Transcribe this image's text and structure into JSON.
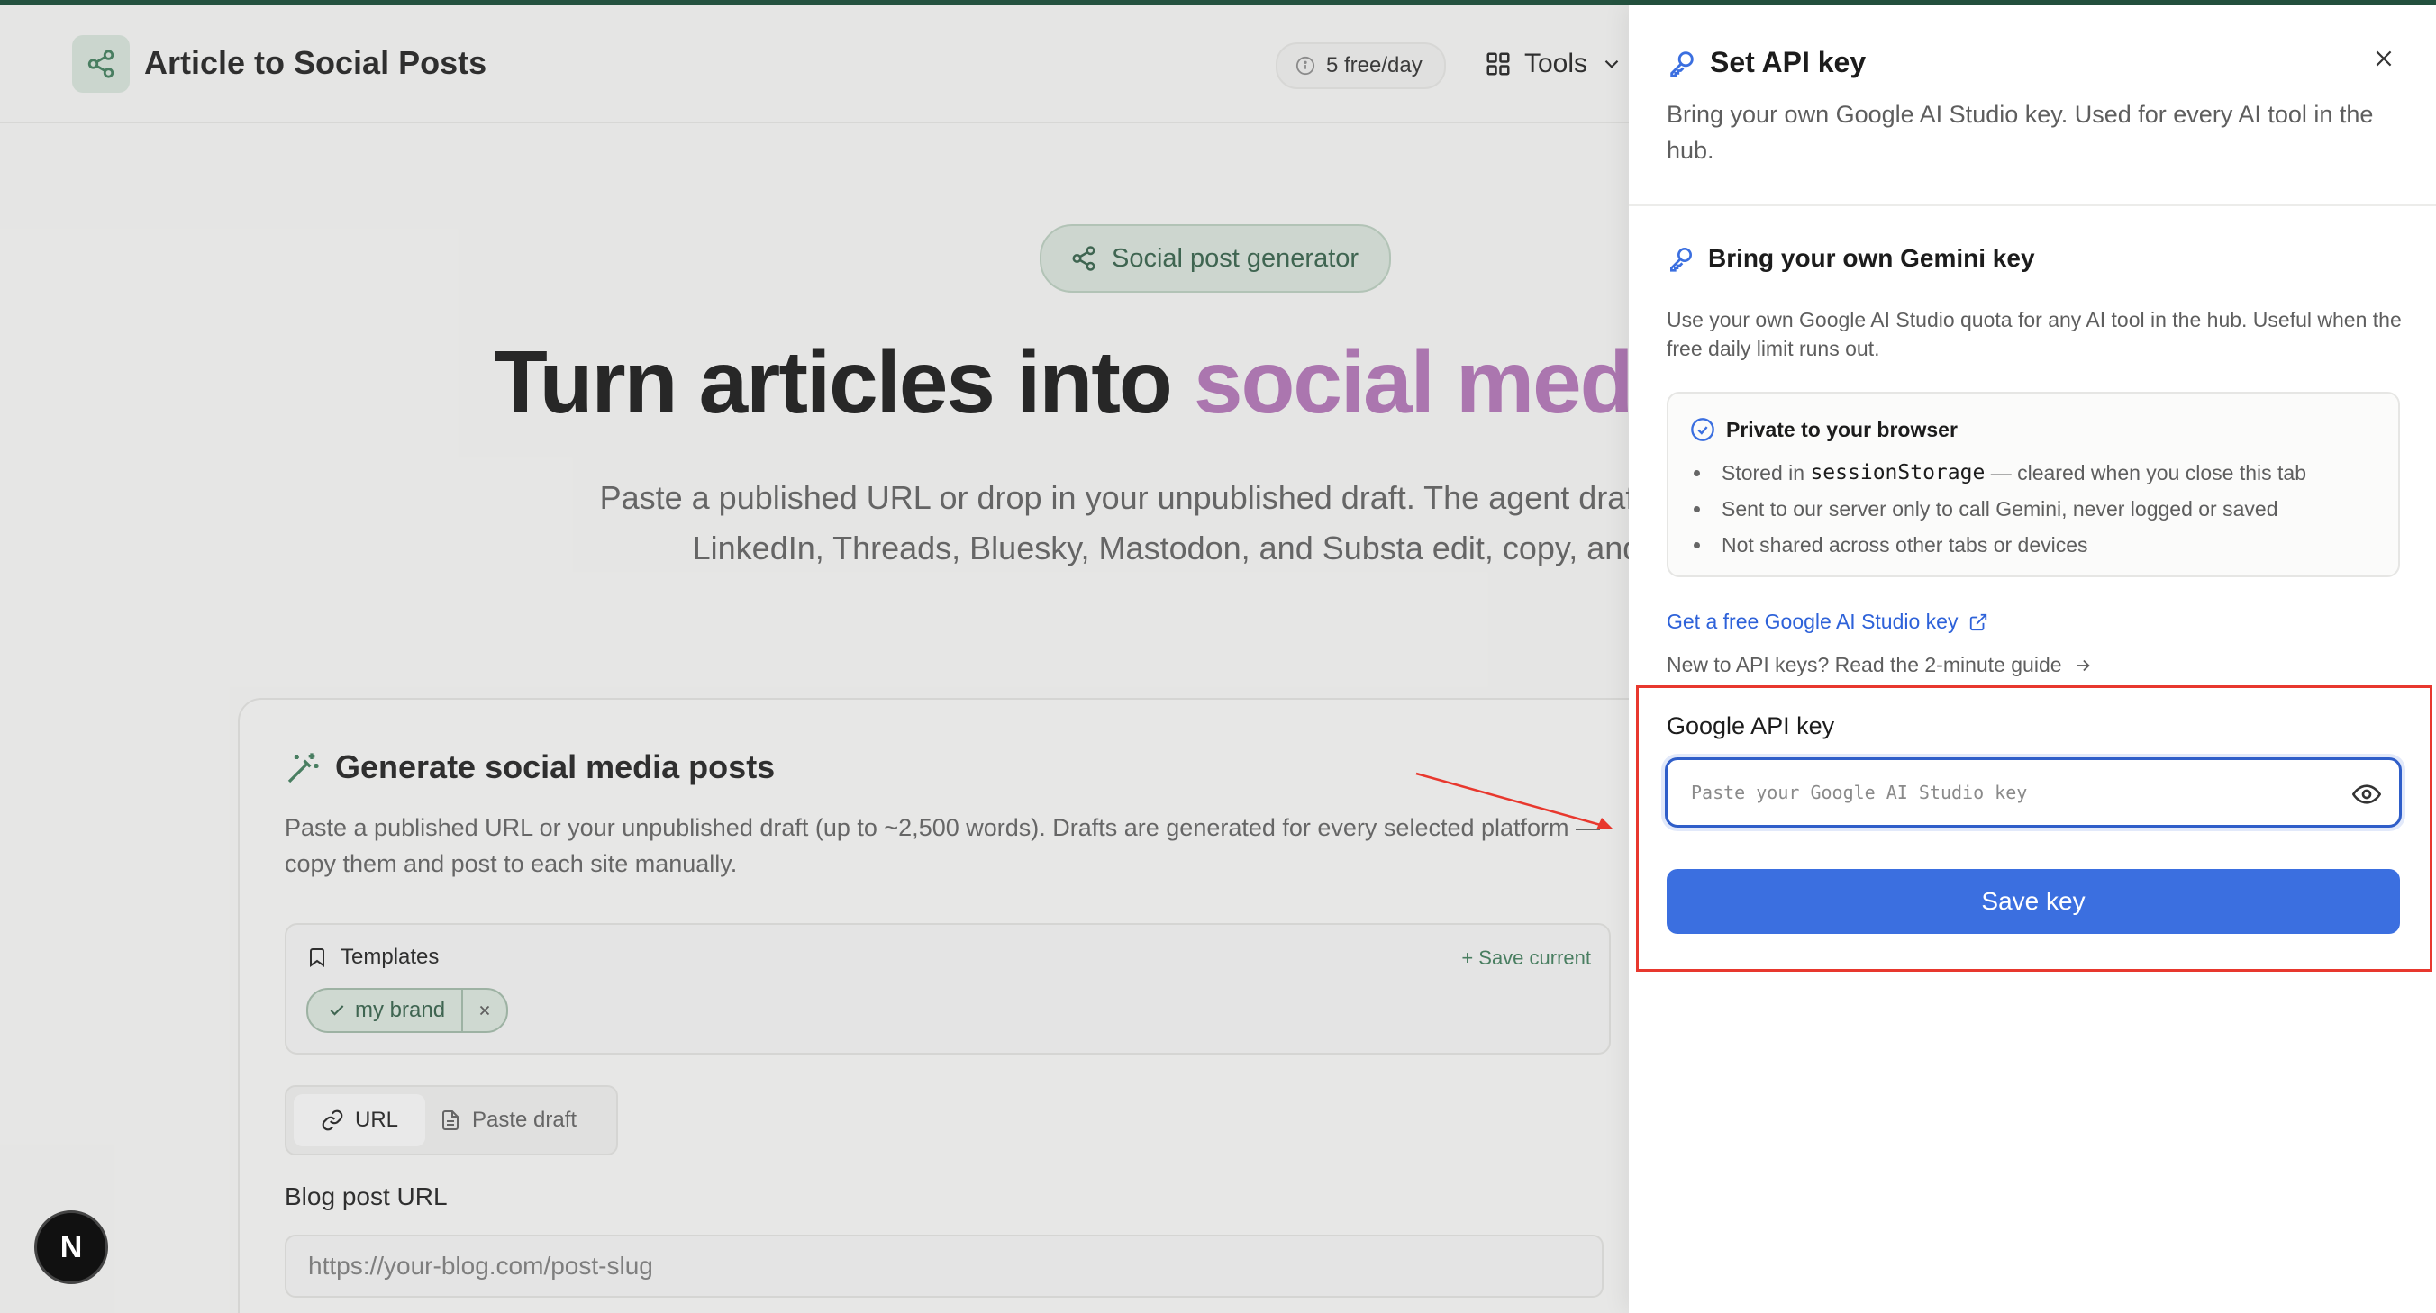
{
  "header": {
    "app_title": "Article to Social Posts",
    "quota": "5 free/day",
    "tools_label": "Tools"
  },
  "hero": {
    "pill_label": "Social post generator",
    "title_main": "Turn articles into ",
    "title_accent": "social med",
    "subtitle": "Paste a published URL or drop in your unpublished draft. The agent drafts posts for X, LinkedIn, Threads, Bluesky, Mastodon, and Substa edit, copy, and share."
  },
  "card": {
    "title": "Generate social media posts",
    "description": "Paste a published URL or your unpublished draft (up to ~2,500 words). Drafts are generated for every selected platform — copy them and post to each site manually.",
    "templates_label": "Templates",
    "save_current": "+ Save current",
    "template_chip": "my brand",
    "tabs": {
      "url": "URL",
      "draft": "Paste draft"
    },
    "url_label": "Blog post URL",
    "url_placeholder": "https://your-blog.com/post-slug"
  },
  "badge": {
    "letter": "N"
  },
  "drawer": {
    "title": "Set API key",
    "description": "Bring your own Google AI Studio key. Used for every AI tool in the hub.",
    "section_title": "Bring your own Gemini key",
    "section_desc": "Use your own Google AI Studio quota for any AI tool in the hub. Useful when the free daily limit runs out.",
    "privacy": {
      "title": "Private to your browser",
      "item1_prefix": "Stored in ",
      "item1_code": "sessionStorage",
      "item1_suffix": " — cleared when you close this tab",
      "item2": "Sent to our server only to call Gemini, never logged or saved",
      "item3": "Not shared across other tabs or devices"
    },
    "link_get_key": "Get a free Google AI Studio key",
    "link_guide": "New to API keys? Read the 2-minute guide",
    "key_label": "Google API key",
    "key_placeholder": "Paste your Google AI Studio key",
    "key_value": "",
    "save_button": "Save key"
  },
  "colors": {
    "brand_green": "#24523f",
    "accent_purple": "#b070b4",
    "primary_blue": "#3b6fe0",
    "highlight_red": "#e8382e"
  }
}
